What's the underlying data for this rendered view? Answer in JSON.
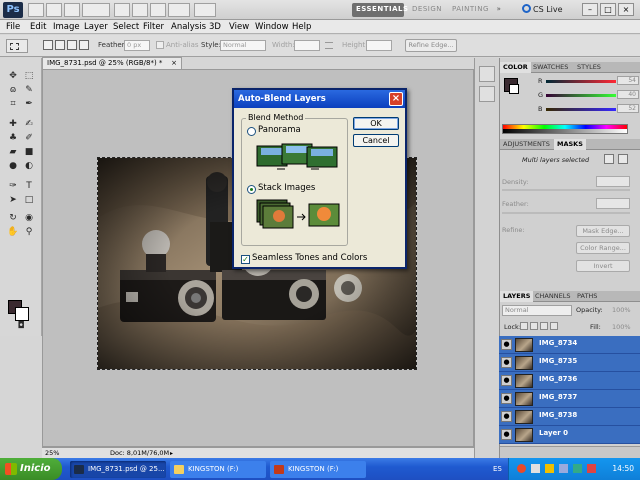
{
  "app": {
    "logo": "Ps",
    "workspaces": [
      "ESSENTIALS",
      "DESIGN",
      "PAINTING",
      "»"
    ],
    "cs_live": "CS Live",
    "window_controls": [
      "–",
      "□",
      "×"
    ]
  },
  "menu": [
    "File",
    "Edit",
    "Image",
    "Layer",
    "Select",
    "Filter",
    "Analysis",
    "3D",
    "View",
    "Window",
    "Help"
  ],
  "options": {
    "feather_label": "Feather:",
    "feather_value": "0 px",
    "antialias_label": "Anti-alias",
    "style_label": "Style:",
    "style_value": "Normal",
    "width_label": "Width:",
    "height_label": "Height:",
    "refine_edge": "Refine Edge..."
  },
  "document": {
    "tab_title": "IMG_8731.psd @ 25% (RGB/8*) *",
    "tab_close": "×",
    "zoom": "25%",
    "doc_size": "Doc: 8,01M/76,0M"
  },
  "dialog": {
    "title": "Auto-Blend Layers",
    "close": "×",
    "group_label": "Blend Method",
    "option_panorama": "Panorama",
    "option_stack": "Stack Images",
    "selected": "Stack Images",
    "ok": "OK",
    "cancel": "Cancel",
    "seamless_label": "Seamless Tones and Colors",
    "seamless_checked": true,
    "check_mark": "✓"
  },
  "color_panel": {
    "tabs": [
      "COLOR",
      "SWATCHES",
      "STYLES"
    ],
    "channels": [
      {
        "label": "R",
        "value": "54",
        "color": "#d03030"
      },
      {
        "label": "G",
        "value": "40",
        "color": "#30a030"
      },
      {
        "label": "B",
        "value": "52",
        "color": "#3050d0"
      }
    ],
    "foreground": "#3a2a30"
  },
  "masks_panel": {
    "tabs": [
      "ADJUSTMENTS",
      "MASKS"
    ],
    "status": "Multi layers selected",
    "density_label": "Density:",
    "feather_label": "Feather:",
    "refine_label": "Refine:",
    "buttons": [
      "Mask Edge...",
      "Color Range...",
      "Invert"
    ]
  },
  "layers_panel": {
    "tabs": [
      "LAYERS",
      "CHANNELS",
      "PATHS"
    ],
    "blend_mode": "Normal",
    "opacity_label": "Opacity:",
    "opacity_value": "100%",
    "lock_label": "Lock:",
    "fill_label": "Fill:",
    "fill_value": "100%",
    "layers": [
      "IMG_8734",
      "IMG_8735",
      "IMG_8736",
      "IMG_8737",
      "IMG_8738",
      "Layer 0"
    ]
  },
  "taskbar": {
    "start": "Inicio",
    "tasks": [
      "IMG_8731.psd @ 25...",
      "KINGSTON (F:)",
      "KINGSTON (F:)"
    ],
    "language": "ES",
    "clock": "14:50"
  }
}
